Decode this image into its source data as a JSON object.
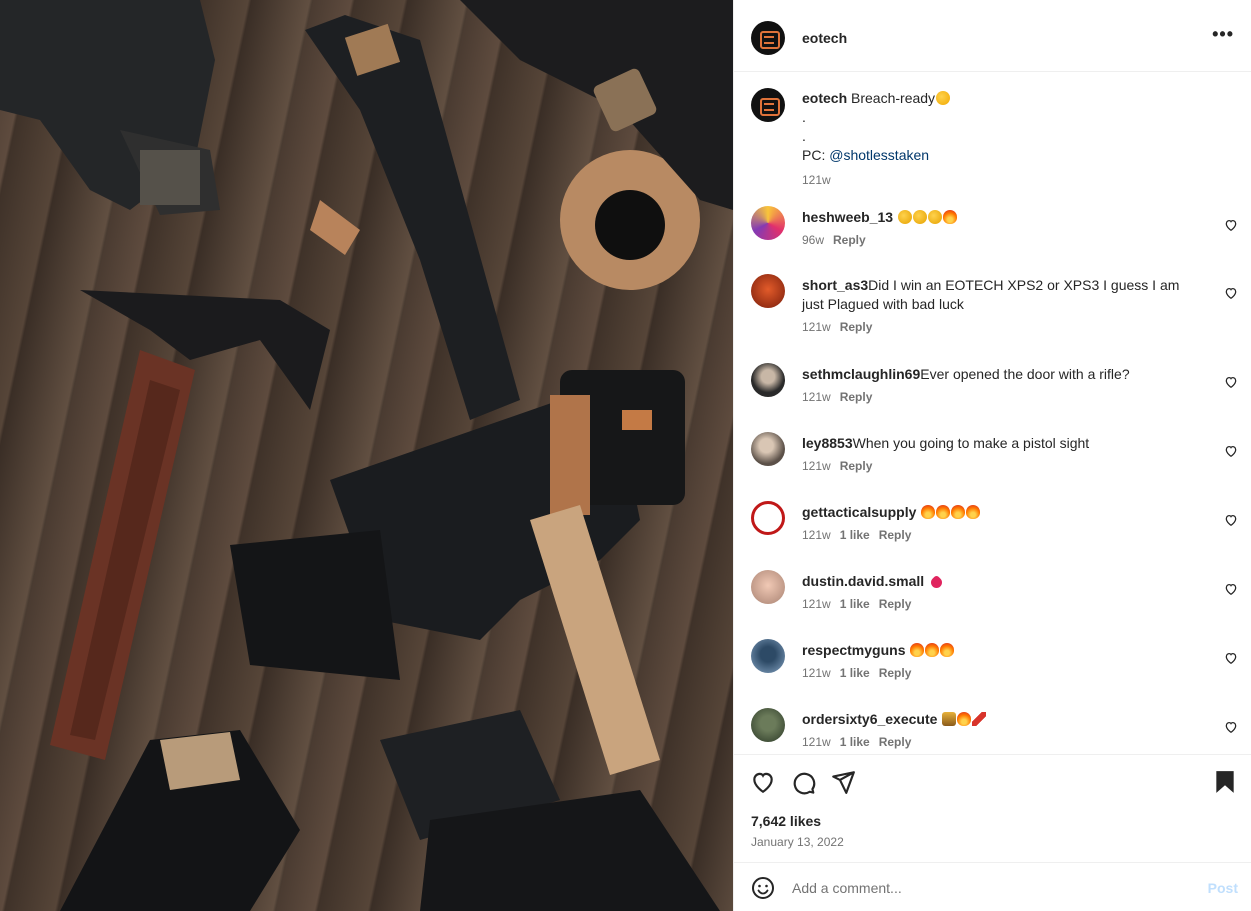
{
  "post": {
    "username": "eotech",
    "more_label": "•••",
    "caption": {
      "username": "eotech",
      "text": "Breach-ready",
      "line2": ".",
      "line3": ".",
      "pc_label": "PC:",
      "mention": "@shotlesstaken",
      "time": "121w"
    }
  },
  "comments": [
    {
      "username": "heshweeb_13",
      "emojis": [
        "clap",
        "clap",
        "clap",
        "fire"
      ],
      "text": "",
      "time": "96w",
      "likes": "",
      "reply": "Reply"
    },
    {
      "username": "short_as3",
      "emojis": [],
      "text": "Did I win an EOTECH XPS2 or XPS3 I guess I am just Plagued with bad luck",
      "time": "121w",
      "likes": "",
      "reply": "Reply"
    },
    {
      "username": "sethmclaughlin69",
      "emojis": [],
      "text": "Ever opened the door with a rifle?",
      "time": "121w",
      "likes": "",
      "reply": "Reply"
    },
    {
      "username": "ley8853",
      "emojis": [],
      "text": "When you going to make a pistol sight",
      "time": "121w",
      "likes": "",
      "reply": "Reply"
    },
    {
      "username": "gettacticalsupply",
      "emojis": [
        "fire",
        "fire",
        "fire",
        "fire"
      ],
      "text": "",
      "time": "121w",
      "likes": "1 like",
      "reply": "Reply"
    },
    {
      "username": "dustin.david.small",
      "emojis": [
        "heart"
      ],
      "text": "",
      "time": "121w",
      "likes": "1 like",
      "reply": "Reply"
    },
    {
      "username": "respectmyguns",
      "emojis": [
        "fire",
        "fire",
        "fire"
      ],
      "text": "",
      "time": "121w",
      "likes": "1 like",
      "reply": "Reply"
    },
    {
      "username": "ordersixty6_execute",
      "emojis": [
        "drum",
        "fire",
        "dyn"
      ],
      "text": "",
      "time": "121w",
      "likes": "1 like",
      "reply": "Reply"
    }
  ],
  "actions": {
    "likes": "7,642 likes",
    "date": "January 13, 2022"
  },
  "add_comment": {
    "placeholder": "Add a comment...",
    "post_label": "Post"
  },
  "colors": {
    "link": "#00376b",
    "muted": "#737373",
    "post_disabled": "#c0dffd",
    "brand_orange": "#e0733a"
  }
}
